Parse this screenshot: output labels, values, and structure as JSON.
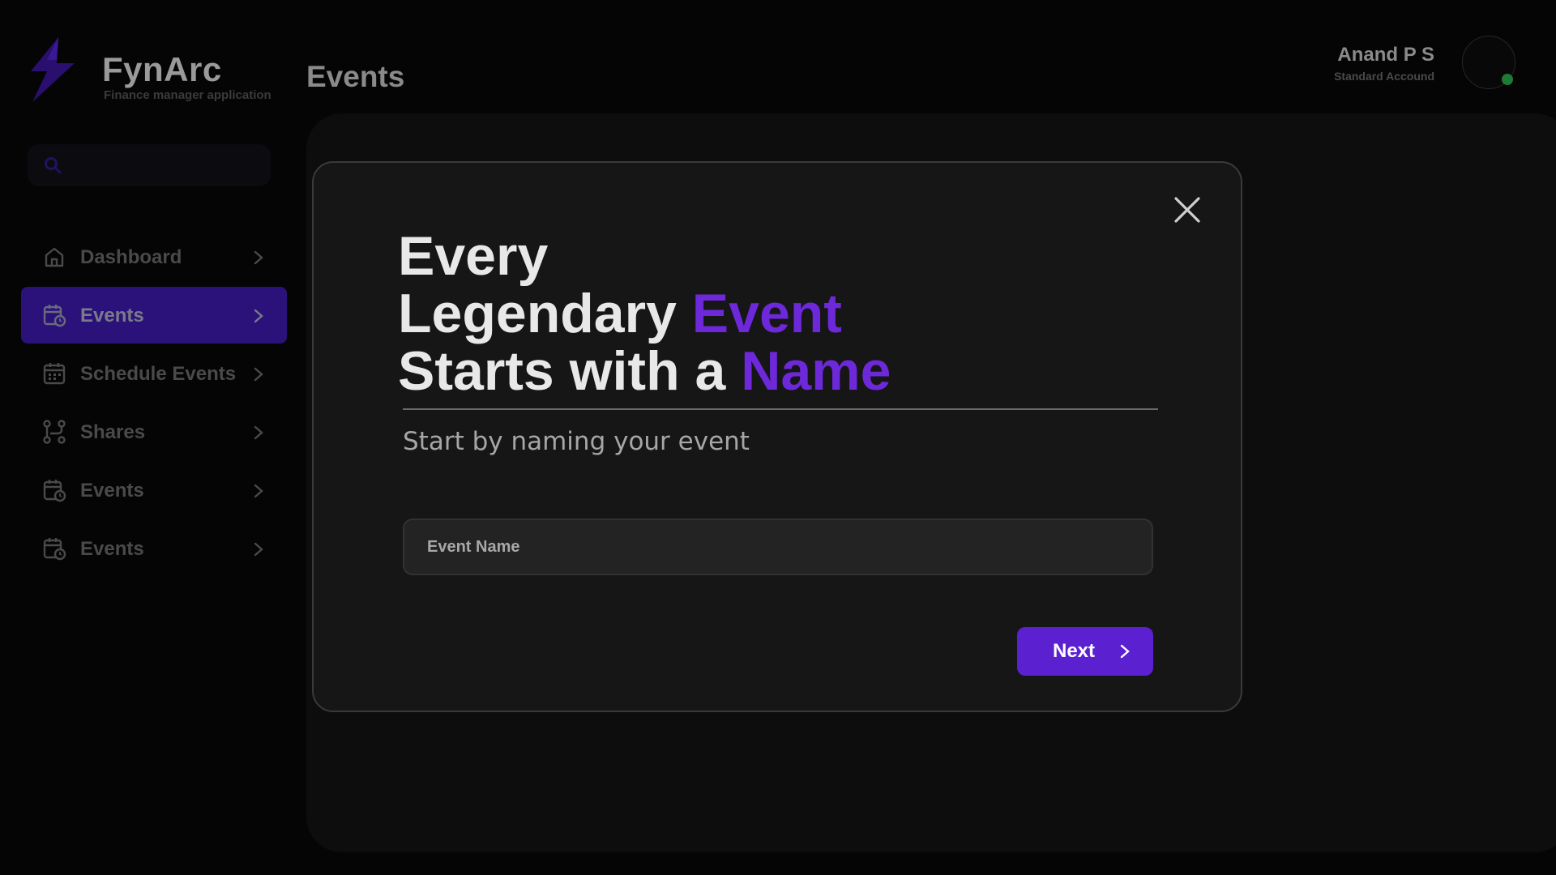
{
  "app": {
    "name": "FynArc",
    "tagline": "Finance manager application"
  },
  "header": {
    "title": "Events",
    "user": {
      "name": "Anand P S",
      "account_type": "Standard Accound"
    }
  },
  "sidebar": {
    "search": {
      "placeholder": "",
      "value": ""
    },
    "items": [
      {
        "label": "Dashboard",
        "icon": "home-icon",
        "active": false
      },
      {
        "label": "Events",
        "icon": "calendar-clock-icon",
        "active": true
      },
      {
        "label": "Schedule Events",
        "icon": "calendar-grid-icon",
        "active": false
      },
      {
        "label": "Shares",
        "icon": "share-nodes-icon",
        "active": false
      },
      {
        "label": "Events",
        "icon": "calendar-clock-icon",
        "active": false
      },
      {
        "label": "Events",
        "icon": "calendar-clock-icon",
        "active": false
      }
    ]
  },
  "modal": {
    "headline": {
      "line1": "Every",
      "line2_prefix": "Legendary ",
      "line2_accent": "Event",
      "line3_prefix": "Starts with a ",
      "line3_accent": "Name"
    },
    "subtitle": "Start by naming your event",
    "event_name_field": {
      "placeholder": "Event Name",
      "value": ""
    },
    "next_label": "Next"
  },
  "colors": {
    "accent": "#6d28d9",
    "active_nav": "#2a127a",
    "button": "#5b21d1",
    "status_online": "#1f7a35"
  }
}
